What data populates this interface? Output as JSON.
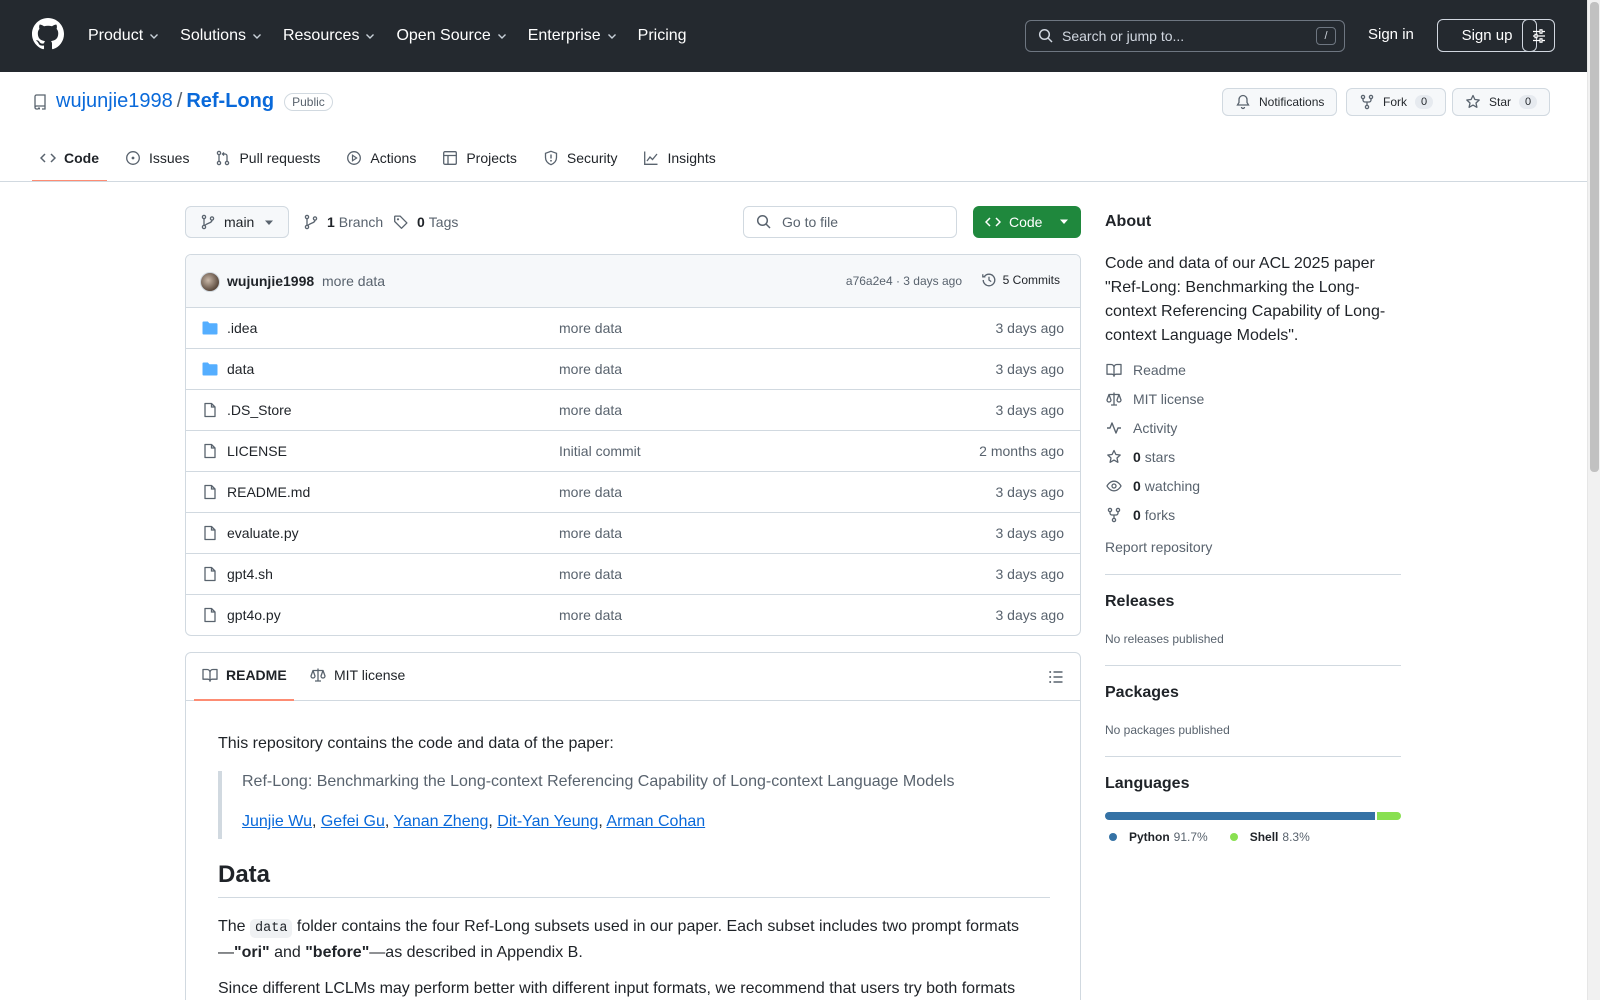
{
  "header": {
    "nav": [
      "Product",
      "Solutions",
      "Resources",
      "Open Source",
      "Enterprise",
      "Pricing"
    ],
    "search_placeholder": "Search or jump to...",
    "search_shortcut": "/",
    "signin": "Sign in",
    "signup": "Sign up"
  },
  "repo": {
    "owner": "wujunjie1998",
    "separator": "/",
    "name": "Ref-Long",
    "visibility": "Public",
    "notifications_label": "Notifications",
    "fork_label": "Fork",
    "fork_count": "0",
    "star_label": "Star",
    "star_count": "0"
  },
  "tabs": [
    "Code",
    "Issues",
    "Pull requests",
    "Actions",
    "Projects",
    "Security",
    "Insights"
  ],
  "browser": {
    "branch": "main",
    "branch_count": "1",
    "branch_label": "Branch",
    "tag_count": "0",
    "tag_label": "Tags",
    "goto_placeholder": "Go to file",
    "code_button": "Code",
    "commit": {
      "author": "wujunjie1998",
      "message": "more data",
      "sha_time": "a76a2e4 · 3 days ago",
      "commits_label": "5 Commits"
    },
    "files": [
      {
        "name": ".idea",
        "type": "folder",
        "message": "more data",
        "date": "3 days ago"
      },
      {
        "name": "data",
        "type": "folder",
        "message": "more data",
        "date": "3 days ago"
      },
      {
        "name": ".DS_Store",
        "type": "file",
        "message": "more data",
        "date": "3 days ago"
      },
      {
        "name": "LICENSE",
        "type": "file",
        "message": "Initial commit",
        "date": "2 months ago"
      },
      {
        "name": "README.md",
        "type": "file",
        "message": "more data",
        "date": "3 days ago"
      },
      {
        "name": "evaluate.py",
        "type": "file",
        "message": "more data",
        "date": "3 days ago"
      },
      {
        "name": "gpt4.sh",
        "type": "file",
        "message": "more data",
        "date": "3 days ago"
      },
      {
        "name": "gpt4o.py",
        "type": "file",
        "message": "more data",
        "date": "3 days ago"
      }
    ]
  },
  "readme": {
    "tab_readme": "README",
    "tab_license": "MIT license",
    "intro": "This repository contains the code and data of the paper:",
    "quote": "Ref-Long: Benchmarking the Long-context Referencing Capability of Long-context Language Models",
    "authors": [
      "Junjie Wu",
      "Gefei Gu",
      "Yanan Zheng",
      "Dit-Yan Yeung",
      "Arman Cohan"
    ],
    "author_sep": ", ",
    "h2": "Data",
    "p1_a": "The ",
    "p1_code": "data",
    "p1_b": " folder contains the four Ref-Long subsets used in our paper. Each subset includes two prompt formats —",
    "p1_ori": "\"ori\"",
    "p1_and": " and ",
    "p1_before": "\"before\"",
    "p1_c": "—as described in Appendix B.",
    "p2": "Since different LCLMs may perform better with different input formats, we recommend that users try both formats"
  },
  "sidebar": {
    "about_title": "About",
    "about_desc": "Code and data of our ACL 2025 paper \"Ref-Long: Benchmarking the Long-context Referencing Capability of Long-context Language Models\".",
    "readme": "Readme",
    "license": "MIT license",
    "activity": "Activity",
    "stars_count": "0",
    "stars_label": "stars",
    "watching_count": "0",
    "watching_label": "watching",
    "forks_count": "0",
    "forks_label": "forks",
    "report": "Report repository",
    "releases_title": "Releases",
    "releases_sub": "No releases published",
    "packages_title": "Packages",
    "packages_sub": "No packages published",
    "languages_title": "Languages",
    "languages": [
      {
        "name": "Python",
        "pct": "91.7%",
        "value": 91.7,
        "color": "#3572A5"
      },
      {
        "name": "Shell",
        "pct": "8.3%",
        "value": 8.3,
        "color": "#89e051"
      }
    ]
  }
}
